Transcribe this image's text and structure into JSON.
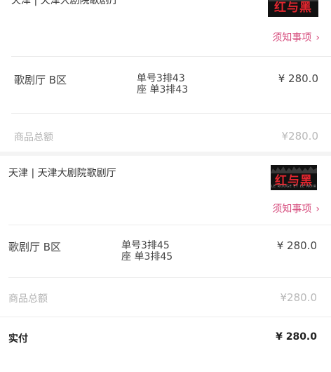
{
  "order1": {
    "venue": "天津 | 天津大剧院歌剧厅",
    "notice_label": "须知事项",
    "hall": "歌剧厅 B区",
    "seat_line1": "单号3排43",
    "seat_line2": "座 单3排43",
    "price": "¥ 280.0",
    "subtotal_label": "商品总额",
    "subtotal_value": "¥280.0"
  },
  "order2": {
    "venue": "天津 | 天津大剧院歌剧厅",
    "poster_title": "红与黑",
    "poster_subtitle": "LE ROUGE ET LE NOIR",
    "notice_label": "须知事项",
    "hall": "歌剧厅 B区",
    "seat_line1": "单号3排45",
    "seat_line2": "座 单3排45",
    "price": "¥ 280.0",
    "subtotal_label": "商品总额",
    "subtotal_value": "¥280.0"
  },
  "payment": {
    "label": "实付",
    "value": "¥ 280.0"
  },
  "colors": {
    "accent": "#d64b7c",
    "poster_red": "#e3262f"
  },
  "icons": {
    "chevron": "chevron-right-icon"
  }
}
